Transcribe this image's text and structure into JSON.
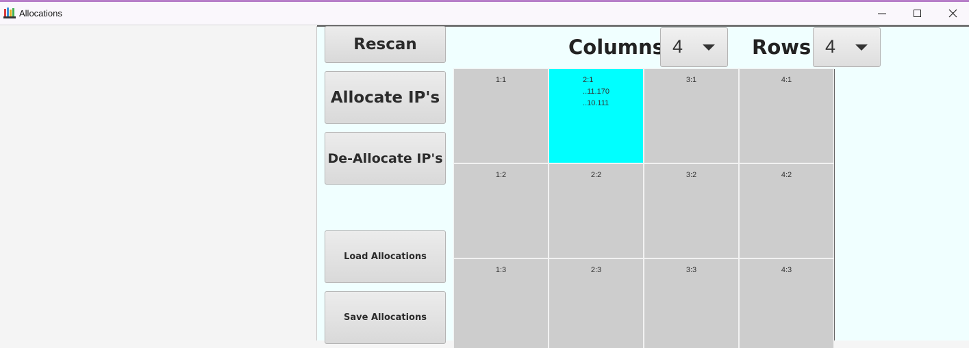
{
  "window": {
    "title": "Allocations",
    "controls": {
      "minimize": "minimize",
      "maximize": "maximize",
      "close": "close"
    }
  },
  "buttons": {
    "rescan": "Rescan",
    "allocate": "Allocate IP's",
    "deallocate": "De-Allocate IP's",
    "load": "Load Allocations",
    "save": "Save Allocations"
  },
  "columns_selector": {
    "label": "Columns",
    "value": "4"
  },
  "rows_selector": {
    "label": "Rows",
    "value": "4"
  },
  "grid": {
    "cells": [
      [
        {
          "label": "1:1"
        },
        {
          "label": "2:1",
          "lines": [
            "..11.170",
            "..10.111"
          ],
          "active": true
        },
        {
          "label": "3:1"
        },
        {
          "label": "4:1"
        }
      ],
      [
        {
          "label": "1:2"
        },
        {
          "label": "2:2"
        },
        {
          "label": "3:2"
        },
        {
          "label": "4:2"
        }
      ],
      [
        {
          "label": "1:3"
        },
        {
          "label": "2:3"
        },
        {
          "label": "3:3"
        },
        {
          "label": "4:3"
        }
      ]
    ],
    "active_color": "#00ffff",
    "cell_color": "#cdcdcd"
  },
  "colors": {
    "background": "#f0ffff",
    "accent_line": "#b77ec9"
  },
  "icons": {
    "app": "app-logo-icon",
    "minimize": "minimize-icon",
    "maximize": "maximize-icon",
    "close": "close-icon"
  }
}
